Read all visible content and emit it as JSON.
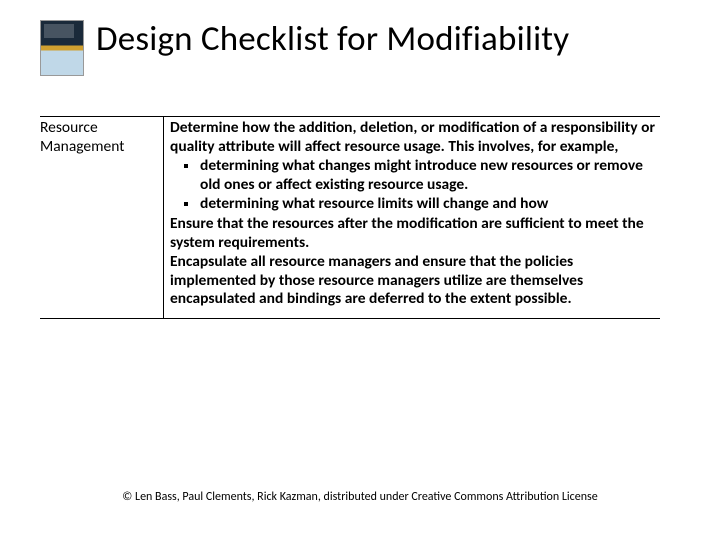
{
  "title": "Design Checklist for Modifiability",
  "table": {
    "leftLabel": "Resource Management",
    "intro": "Determine how the addition, deletion, or modification of a responsibility or quality attribute will affect resource usage.  This involves, for example,",
    "bullets": [
      "determining what changes might introduce new resources or remove old ones or affect existing resource usage.",
      "determining what resource limits will change and how"
    ],
    "para2": "Ensure that the resources after the modification are sufficient to meet the system requirements.",
    "para3": "Encapsulate all resource managers and ensure that the policies implemented by those resource managers utilize are themselves encapsulated and bindings are deferred to the extent possible."
  },
  "footer": "© Len Bass, Paul Clements, Rick Kazman, distributed under Creative Commons Attribution License"
}
